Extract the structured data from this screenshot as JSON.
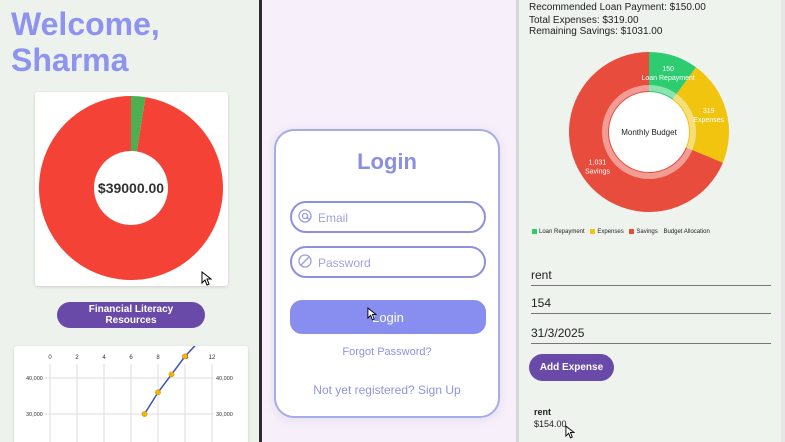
{
  "left": {
    "welcome": "Welcome, Sharma",
    "donut": {
      "center_label": "$39000.00",
      "colors": {
        "main": "#f44336",
        "minor": "#4caf50"
      },
      "slices": [
        {
          "value": 0.975
        },
        {
          "value": 0.025
        }
      ]
    },
    "fin_lit_button": "Financial Literacy Resources",
    "chart_data": {
      "type": "line",
      "x_ticks": [
        "0",
        "2",
        "4",
        "6",
        "8",
        "10",
        "12"
      ],
      "y_ticks_left": [
        "40,000",
        "30,000"
      ],
      "y_ticks_right": [
        "40,000",
        "30,000"
      ],
      "xlim": [
        0,
        12
      ],
      "series": [
        {
          "points": [
            [
              7,
              30000
            ],
            [
              8,
              36000
            ],
            [
              9,
              41000
            ],
            [
              10,
              46000
            ],
            [
              11,
              50000
            ],
            [
              12,
              53000
            ]
          ]
        }
      ]
    }
  },
  "login": {
    "title": "Login",
    "email_placeholder": "Email",
    "password_placeholder": "Password",
    "button": "Login",
    "forgot": "Forgot Password?",
    "signup": "Not yet registered? Sign Up"
  },
  "right": {
    "summary": [
      "Recommended Loan Payment: $150.00",
      "Total Expenses: $319.00",
      "Remaining Savings: $1031.00"
    ],
    "pie": {
      "center": "Monthly Budget",
      "slices": [
        {
          "value": 150,
          "label": "150",
          "sub": "Loan Repayment",
          "color": "#2ecc71"
        },
        {
          "value": 319,
          "label": "319",
          "sub": "Expenses",
          "color": "#f1c40f"
        },
        {
          "value": 1031,
          "label": "1,031",
          "sub": "Savings",
          "color": "#e74c3c"
        }
      ]
    },
    "legend": [
      {
        "label": "Loan Repayment",
        "color": "#2ecc71"
      },
      {
        "label": "Expenses",
        "color": "#f1c40f"
      },
      {
        "label": "Savings",
        "color": "#e74c3c"
      }
    ],
    "legend_title": "Budget Allocation",
    "inputs": {
      "name": "rent",
      "amount": "154",
      "date": "31/3/2025"
    },
    "add_button": "Add Expense",
    "expense": {
      "name": "rent",
      "amount": "$154.00"
    }
  }
}
